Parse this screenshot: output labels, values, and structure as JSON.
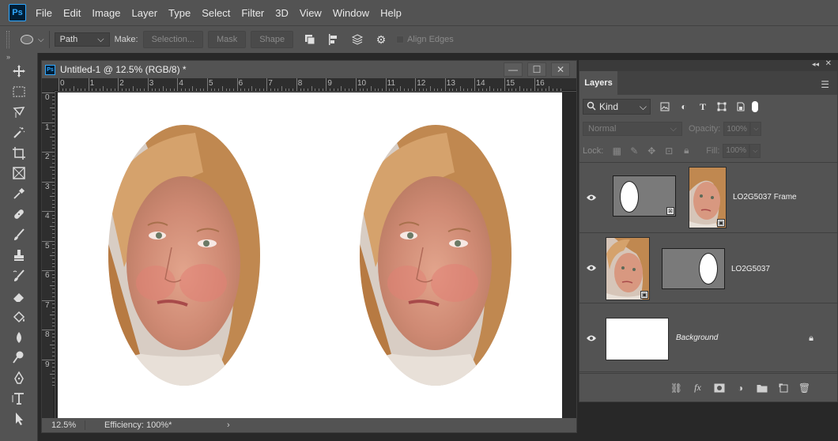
{
  "app": {
    "logo": "Ps"
  },
  "menu": [
    "File",
    "Edit",
    "Image",
    "Layer",
    "Type",
    "Select",
    "Filter",
    "3D",
    "View",
    "Window",
    "Help"
  ],
  "options": {
    "mode_value": "Path",
    "make_label": "Make:",
    "selection_btn": "Selection...",
    "mask_btn": "Mask",
    "shape_btn": "Shape",
    "align_edges": "Align Edges"
  },
  "tools": [
    "move-tool-icon",
    "marquee-tool-icon",
    "lasso-tool-icon",
    "magic-wand-icon",
    "crop-tool-icon",
    "frame-tool-icon",
    "eyedropper-icon",
    "healing-brush-icon",
    "brush-tool-icon",
    "clone-stamp-icon",
    "history-brush-icon",
    "eraser-icon",
    "paint-bucket-icon",
    "blur-tool-icon",
    "dodge-tool-icon",
    "pen-tool-icon",
    "type-tool-icon",
    "path-selection-icon"
  ],
  "document": {
    "title": "Untitled-1 @ 12.5% (RGB/8) *",
    "ruler_h": [
      "0",
      "1",
      "2",
      "3",
      "4",
      "5",
      "6",
      "7",
      "8",
      "9",
      "10",
      "11",
      "12",
      "13",
      "14",
      "15",
      "16"
    ],
    "ruler_v": [
      "0",
      "1",
      "2",
      "3",
      "4",
      "5",
      "6",
      "7",
      "8",
      "9"
    ],
    "zoom": "12.5%",
    "efficiency": "Efficiency: 100%*"
  },
  "layers_panel": {
    "tab": "Layers",
    "kind": "Kind",
    "blend_mode": "Normal",
    "opacity_label": "Opacity:",
    "opacity_value": "100%",
    "lock_label": "Lock:",
    "fill_label": "Fill:",
    "fill_value": "100%",
    "layers": [
      {
        "name": "LO2G5037 Frame"
      },
      {
        "name": "LO2G5037"
      },
      {
        "name": "Background"
      }
    ]
  },
  "colors": {
    "accent": "#31a8ff",
    "ui_bg": "#535353",
    "dark_bg": "#282828"
  }
}
